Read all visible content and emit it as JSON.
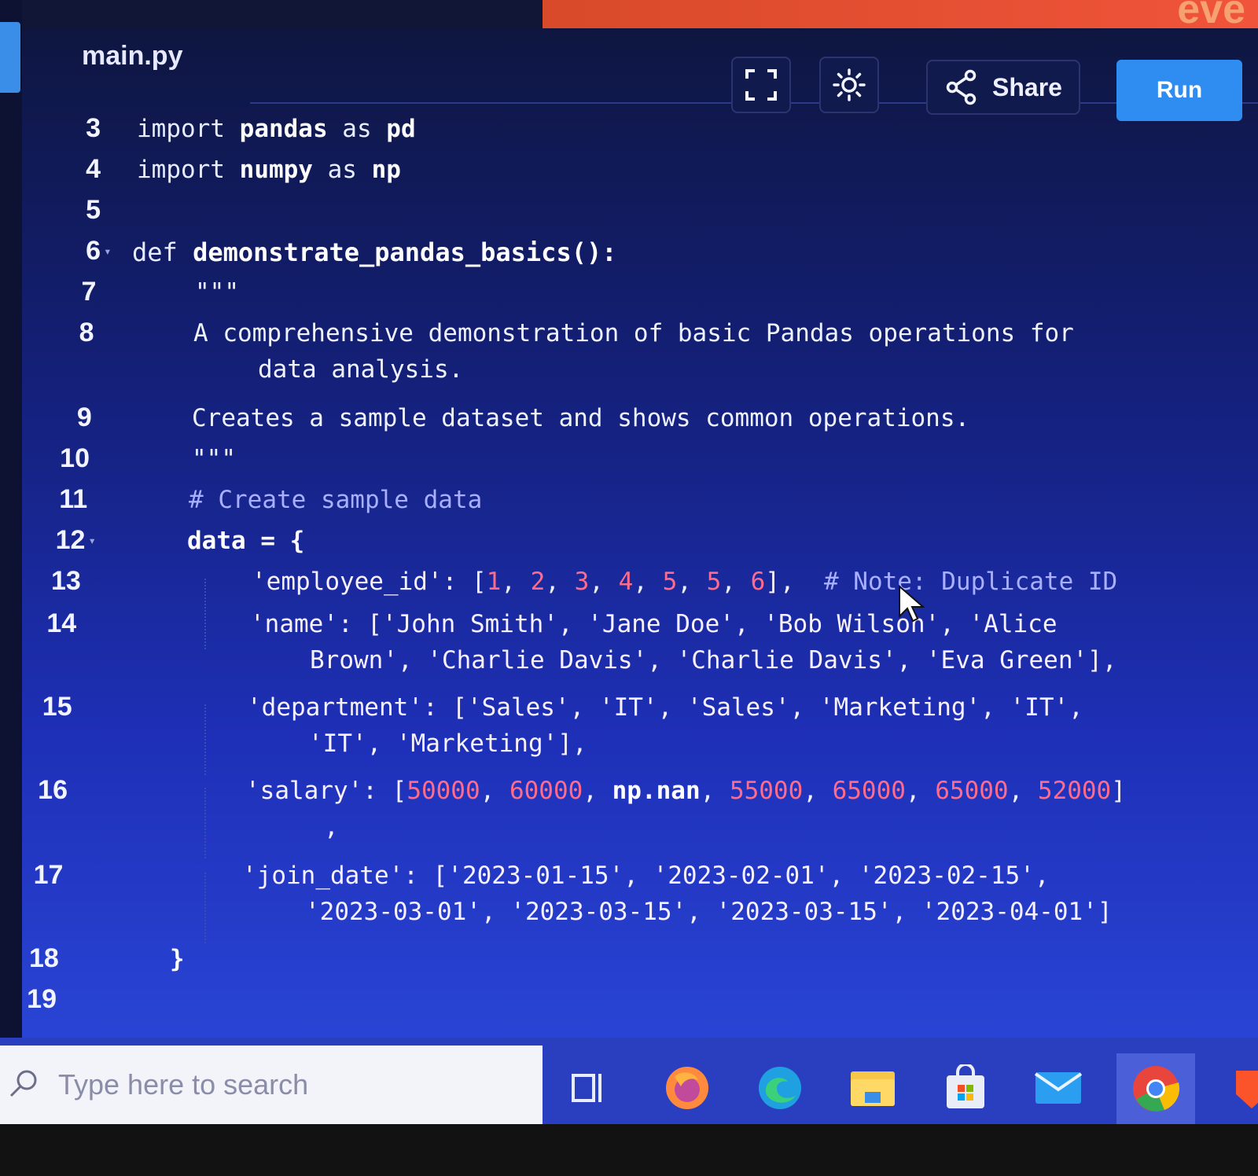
{
  "top_banner": {
    "text": "eve"
  },
  "editor": {
    "file_name": "main.py",
    "toolbar": {
      "fullscreen_icon": "fullscreen-icon",
      "theme_icon": "sun-icon",
      "share_label": "Share",
      "run_label": "Run"
    },
    "lines": [
      {
        "n": "3",
        "text": "import pandas as pd"
      },
      {
        "n": "4",
        "text": "import numpy as np"
      },
      {
        "n": "5",
        "text": ""
      },
      {
        "n": "6",
        "text": "def demonstrate_pandas_basics():"
      },
      {
        "n": "7",
        "text": "\"\"\""
      },
      {
        "n": "8",
        "text": "A comprehensive demonstration of basic Pandas operations for",
        "wrap": "data analysis."
      },
      {
        "n": "9",
        "text": "Creates a sample dataset and shows common operations."
      },
      {
        "n": "10",
        "text": "\"\"\""
      },
      {
        "n": "11",
        "text": "# Create sample data"
      },
      {
        "n": "12",
        "text": "data = {"
      },
      {
        "n": "13",
        "key": "'employee_id': [",
        "vals": [
          "1",
          "2",
          "3",
          "4",
          "5",
          "5",
          "6"
        ],
        "tail": "],",
        "comment": "# Note: Duplicate ID"
      },
      {
        "n": "14",
        "text": "'name': ['John Smith', 'Jane Doe', 'Bob Wilson', 'Alice",
        "wrap": "Brown', 'Charlie Davis', 'Charlie Davis', 'Eva Green'],"
      },
      {
        "n": "15",
        "text": "'department': ['Sales', 'IT', 'Sales', 'Marketing', 'IT',",
        "wrap": "'IT', 'Marketing'],"
      },
      {
        "n": "16",
        "key": "'salary': [",
        "vals": [
          "50000",
          "60000",
          "np.nan",
          "55000",
          "65000",
          "65000",
          "52000"
        ],
        "tail": "]",
        "wrap": ","
      },
      {
        "n": "17",
        "text": "'join_date': ['2023-01-15', '2023-02-01', '2023-02-15',",
        "wrap": "'2023-03-01', '2023-03-15', '2023-03-15', '2023-04-01']"
      },
      {
        "n": "18",
        "text": "}"
      },
      {
        "n": "19",
        "text": ""
      }
    ]
  },
  "taskbar": {
    "search_placeholder": "Type here to search",
    "apps": [
      "task-view-icon",
      "firefox-icon",
      "edge-icon",
      "file-explorer-icon",
      "store-icon",
      "mail-icon",
      "chrome-icon",
      "brave-icon"
    ]
  }
}
